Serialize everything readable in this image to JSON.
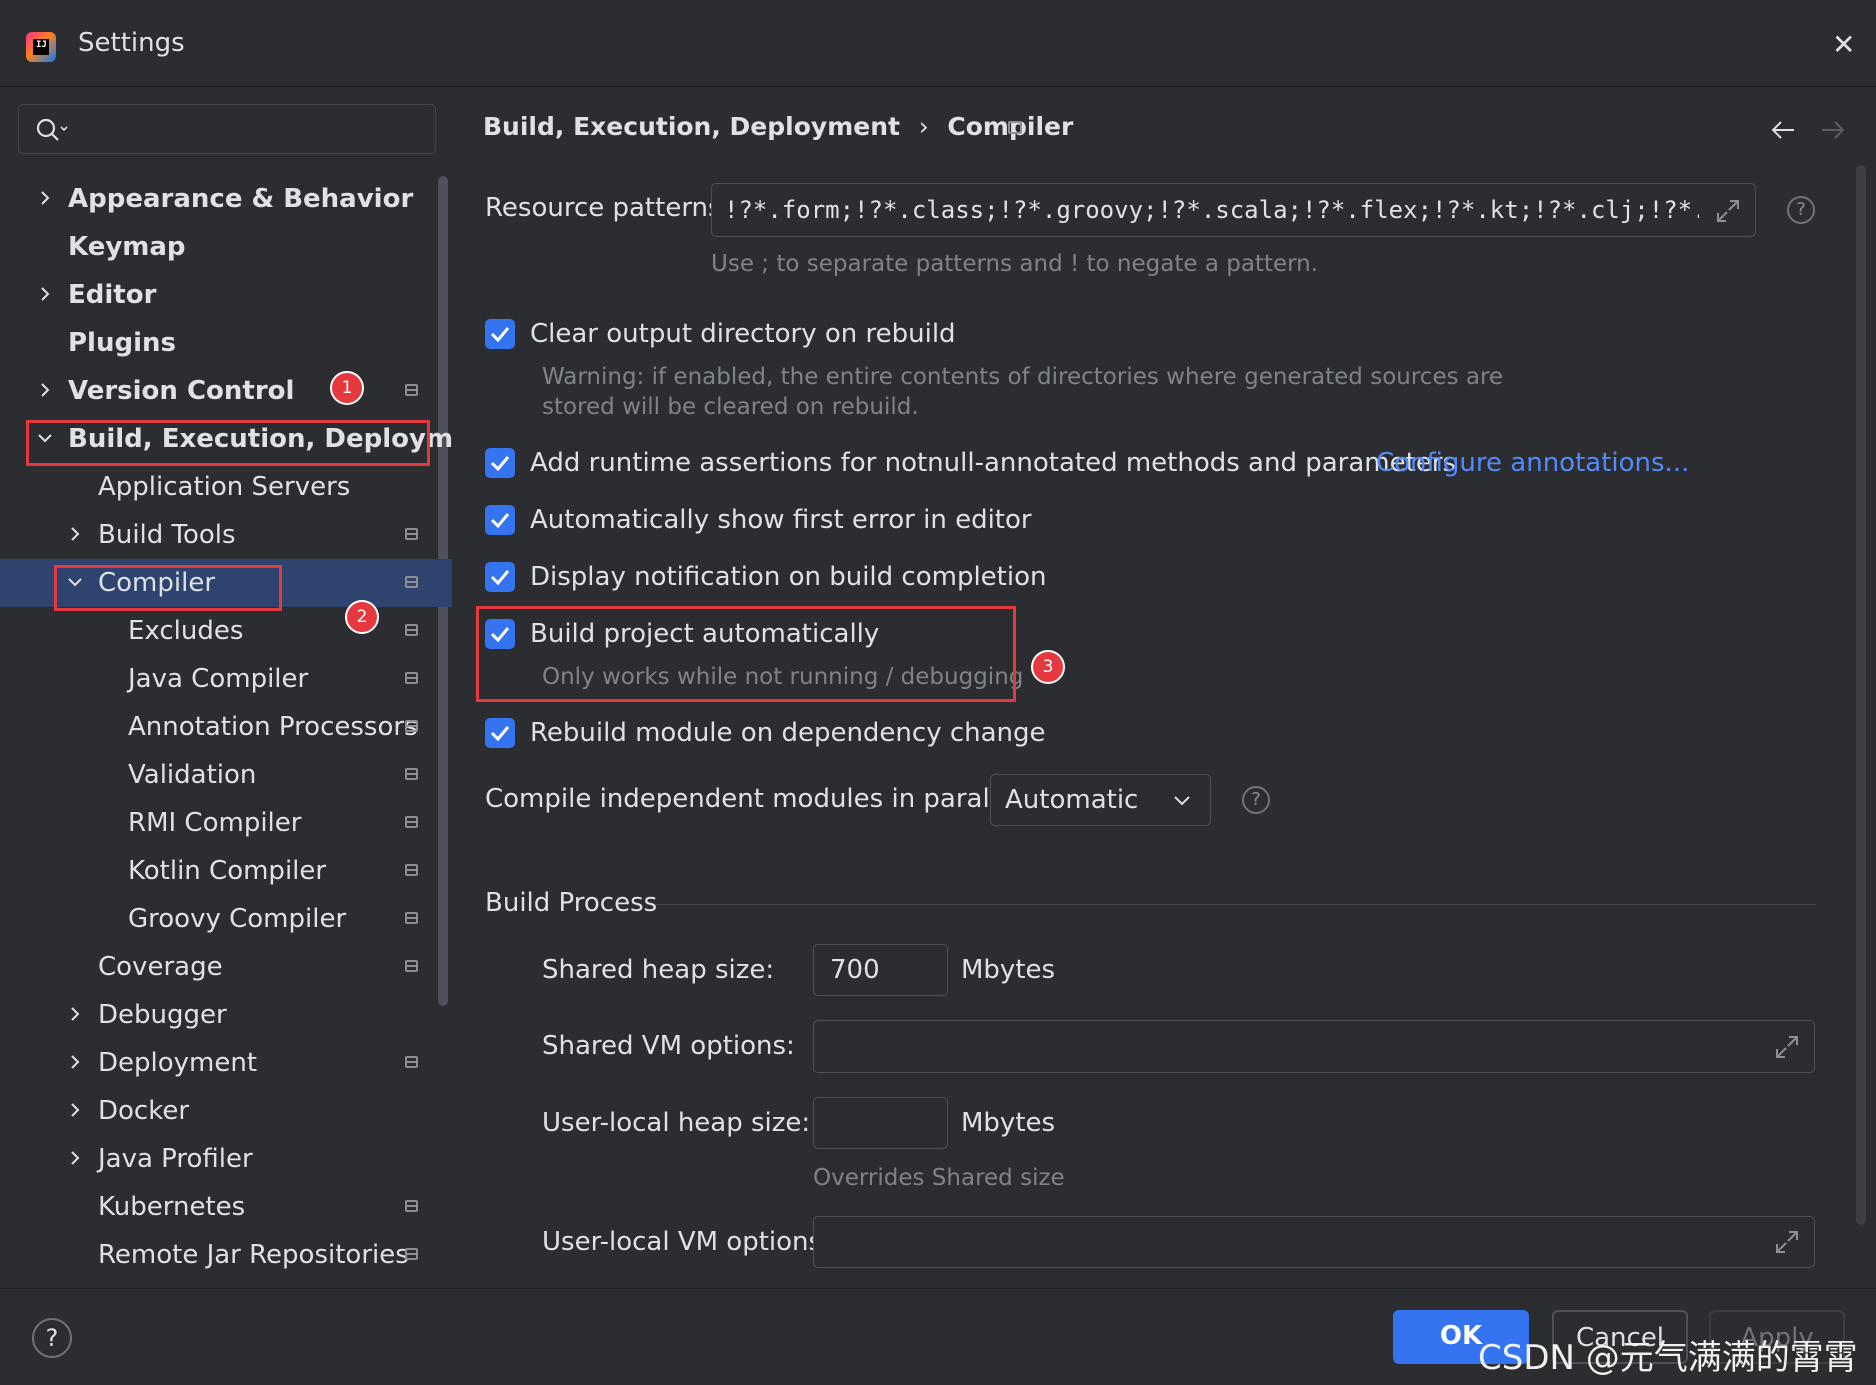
{
  "window": {
    "title": "Settings"
  },
  "sidebar": {
    "items": [
      {
        "label": "Appearance & Behavior"
      },
      {
        "label": "Keymap"
      },
      {
        "label": "Editor"
      },
      {
        "label": "Plugins"
      },
      {
        "label": "Version Control"
      },
      {
        "label": "Build, Execution, Deploymen"
      },
      {
        "label": "Application Servers"
      },
      {
        "label": "Build Tools"
      },
      {
        "label": "Compiler"
      },
      {
        "label": "Excludes"
      },
      {
        "label": "Java Compiler"
      },
      {
        "label": "Annotation Processors"
      },
      {
        "label": "Validation"
      },
      {
        "label": "RMI Compiler"
      },
      {
        "label": "Kotlin Compiler"
      },
      {
        "label": "Groovy Compiler"
      },
      {
        "label": "Coverage"
      },
      {
        "label": "Debugger"
      },
      {
        "label": "Deployment"
      },
      {
        "label": "Docker"
      },
      {
        "label": "Java Profiler"
      },
      {
        "label": "Kubernetes"
      },
      {
        "label": "Remote Jar Repositories"
      }
    ]
  },
  "annotations": {
    "badge1": "1",
    "badge2": "2",
    "badge3": "3"
  },
  "breadcrumb": {
    "parent": "Build, Execution, Deployment",
    "separator": "›",
    "current": "Compiler"
  },
  "compiler": {
    "resource_patterns_label": "Resource patterns:",
    "resource_patterns_value": "!?*.form;!?*.class;!?*.groovy;!?*.scala;!?*.flex;!?*.kt;!?*.clj;!?*.aj",
    "resource_patterns_hint": "Use ; to separate patterns and ! to negate a pattern.",
    "clear_output_label": "Clear output directory on rebuild",
    "clear_output_warning_1": "Warning: if enabled, the entire contents of directories where generated sources are",
    "clear_output_warning_2": "stored will be cleared on rebuild.",
    "runtime_assertions_label": "Add runtime assertions for notnull-annotated methods and parameters",
    "configure_annotations_link": "Configure annotations...",
    "show_first_error_label": "Automatically show first error in editor",
    "display_notification_label": "Display notification on build completion",
    "build_auto_label": "Build project automatically",
    "build_auto_hint": "Only works while not running / debugging",
    "rebuild_module_label": "Rebuild module on dependency change",
    "parallel_label": "Compile independent modules in parallel:",
    "parallel_value": "Automatic",
    "help_glyph": "?"
  },
  "build_process": {
    "section_title": "Build Process",
    "shared_heap_label": "Shared heap size:",
    "shared_heap_value": "700",
    "shared_heap_unit": "Mbytes",
    "shared_vm_label": "Shared VM options:",
    "shared_vm_value": "",
    "user_heap_label": "User-local heap size:",
    "user_heap_value": "",
    "user_heap_unit": "Mbytes",
    "user_heap_hint": "Overrides Shared size",
    "user_vm_label": "User-local VM options:",
    "user_vm_value": ""
  },
  "footer": {
    "help_glyph": "?",
    "ok_label": "OK",
    "cancel_label": "Cancel",
    "apply_label": "Apply",
    "watermark": "CSDN @元气满满的霄霄"
  },
  "colors": {
    "accent": "#3574f0",
    "annotation": "#e5393f",
    "link": "#548af7",
    "background": "#2b2d30",
    "selected": "#2e436e"
  }
}
